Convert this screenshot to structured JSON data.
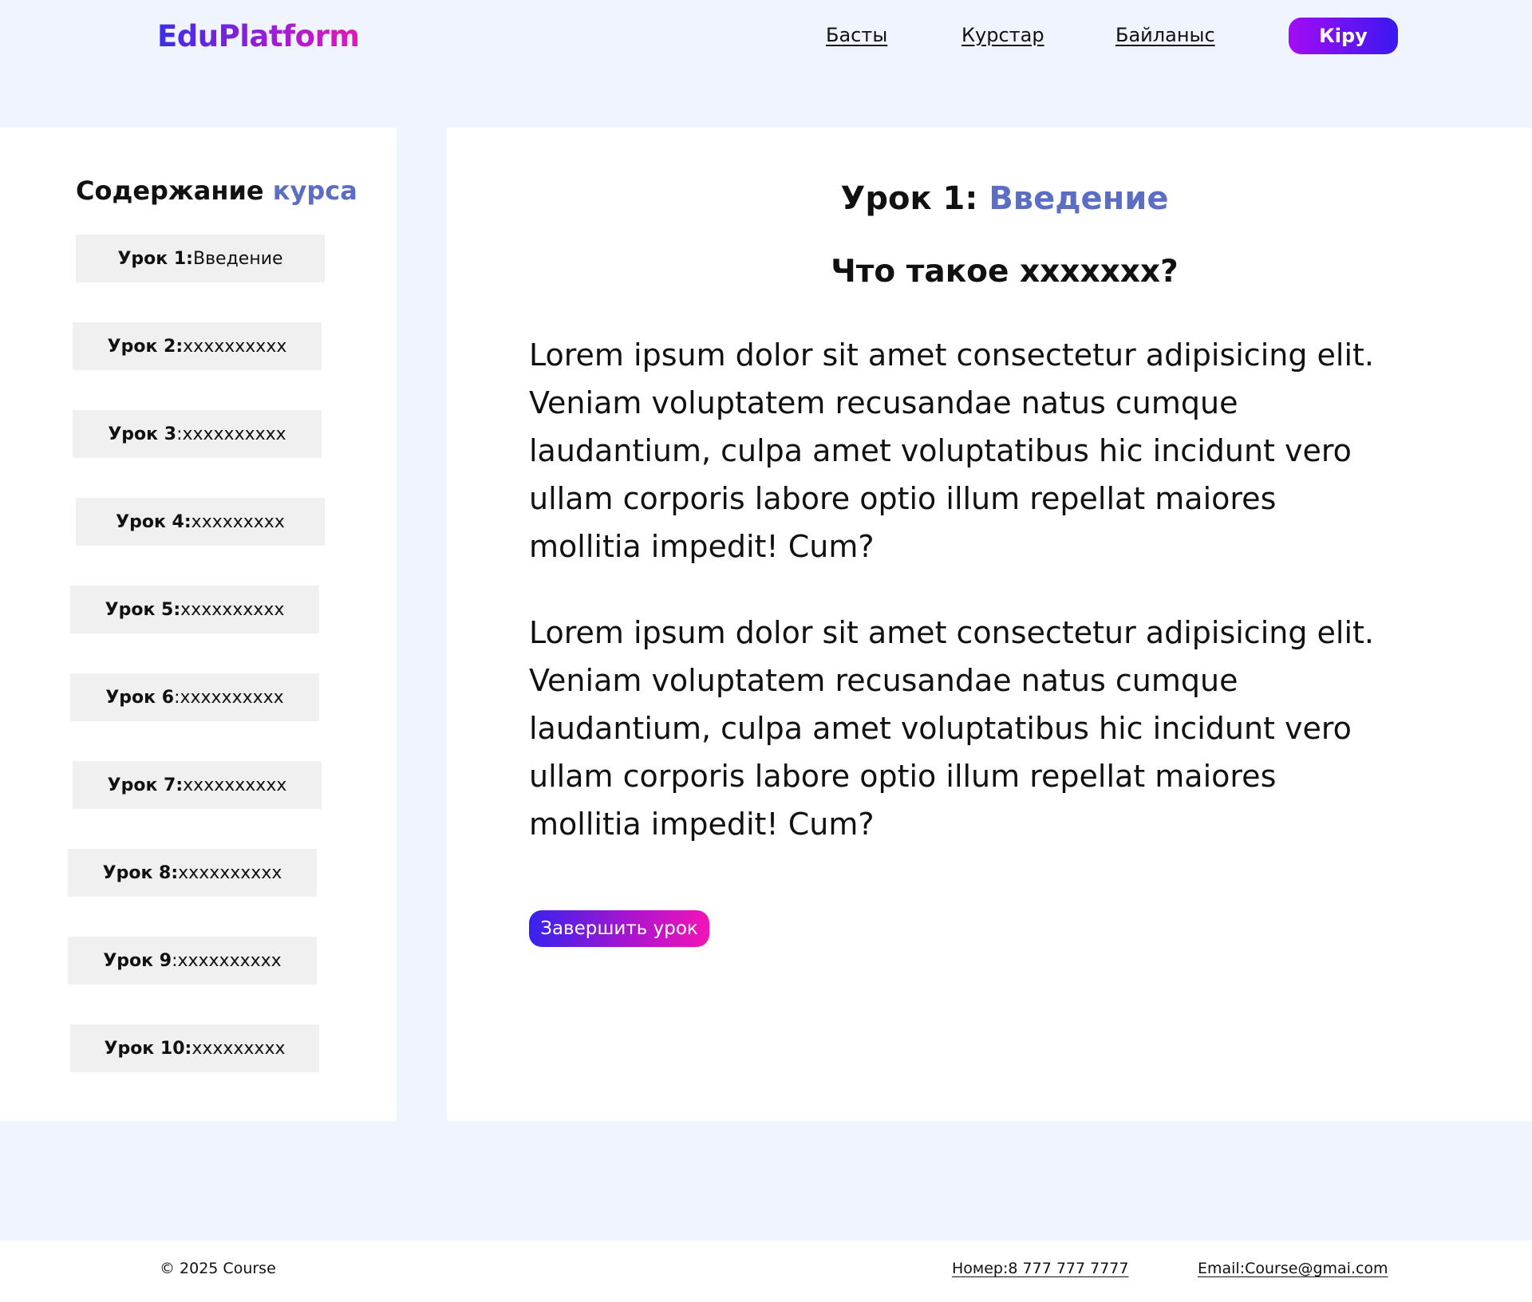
{
  "header": {
    "logo": "EduPlatform",
    "nav": {
      "home": "Басты",
      "courses": "Курстар",
      "contact": "Байланыс"
    },
    "login_label": "Кіру"
  },
  "sidebar": {
    "title_main": "Содержание",
    "title_accent": "курса",
    "items": [
      {
        "prefix": "Урок 1:",
        "text": "Введение"
      },
      {
        "prefix": "Урок 2:",
        "text": "xxxxxxxxxx"
      },
      {
        "prefix": "Урок 3",
        "text": ":xxxxxxxxxx"
      },
      {
        "prefix": "Урок 4:",
        "text": "xxxxxxxxx"
      },
      {
        "prefix": "Урок 5:",
        "text": "xxxxxxxxxx"
      },
      {
        "prefix": "Урок 6",
        "text": ":xxxxxxxxxx"
      },
      {
        "prefix": "Урок 7:",
        "text": "xxxxxxxxxx"
      },
      {
        "prefix": "Урок 8:",
        "text": "xxxxxxxxxx"
      },
      {
        "prefix": "Урок 9",
        "text": ":xxxxxxxxxx"
      },
      {
        "prefix": "Урок 10:",
        "text": "xxxxxxxxx"
      }
    ]
  },
  "main": {
    "title_prefix": "Урок 1: ",
    "title_accent": "Введение",
    "subtitle": "Что такое xxxxxxx?",
    "paragraphs": [
      "Lorem ipsum dolor sit amet consectetur adipisicing elit. Veniam voluptatem recusandae natus cumque laudantium, culpa amet voluptatibus hic incidunt vero ullam corporis labore optio illum repellat maiores mollitia impedit! Cum?",
      "Lorem ipsum dolor sit amet consectetur adipisicing elit. Veniam voluptatem recusandae natus cumque laudantium, culpa amet voluptatibus hic incidunt vero ullam corporis labore optio illum repellat maiores mollitia impedit! Cum?"
    ],
    "finish_label": "Завершить урок"
  },
  "footer": {
    "copyright": "© 2025 Course",
    "phone": "Номер:8 777 777 7777",
    "email": "Email:Course@gmai.com"
  },
  "colors": {
    "page_background": "#eff4fe",
    "accent_blue": "#5b6dc4",
    "lesson_item_background": "#f0f0f0",
    "gradient_start": "#3c2fe6",
    "gradient_end": "#e21bb6"
  }
}
